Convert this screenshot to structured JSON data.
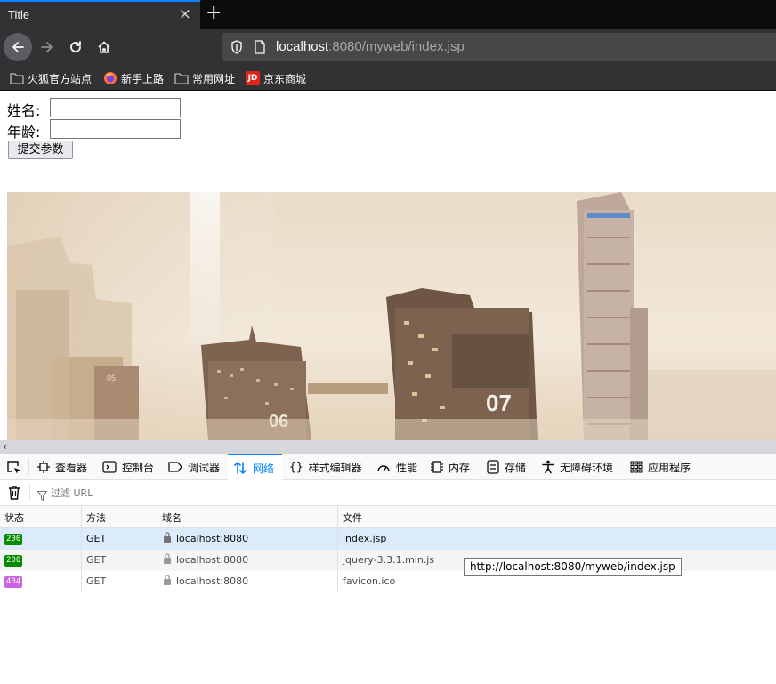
{
  "browser": {
    "tab_title": "Title",
    "tab_close": "×",
    "new_tab": "+",
    "url_host": "localhost",
    "url_rest": ":8080/myweb/index.jsp"
  },
  "bookmarks": [
    {
      "label": "火狐官方站点",
      "icon": "folder-icon"
    },
    {
      "label": "新手上路",
      "icon": "firefox-icon"
    },
    {
      "label": "常用网址",
      "icon": "folder-icon"
    },
    {
      "label": "京东商城",
      "icon": "jd-icon",
      "badge": "JD"
    }
  ],
  "form": {
    "name_label": "姓名:",
    "name_value": "",
    "age_label": "年龄:",
    "age_value": "",
    "submit_label": "提交参数"
  },
  "banner": {
    "building_1_number": "06",
    "building_2_number": "07",
    "building_3_number": "05"
  },
  "devtools": {
    "tabs": [
      {
        "label": "查看器",
        "icon": "inspector-icon"
      },
      {
        "label": "控制台",
        "icon": "console-icon"
      },
      {
        "label": "调试器",
        "icon": "debugger-icon"
      },
      {
        "label": "网络",
        "icon": "network-icon",
        "active": true
      },
      {
        "label": "样式编辑器",
        "icon": "style-editor-icon"
      },
      {
        "label": "性能",
        "icon": "performance-icon"
      },
      {
        "label": "内存",
        "icon": "memory-icon"
      },
      {
        "label": "存储",
        "icon": "storage-icon"
      },
      {
        "label": "无障碍环境",
        "icon": "accessibility-icon"
      },
      {
        "label": "应用程序",
        "icon": "application-icon"
      }
    ],
    "filter_placeholder": "过滤 URL",
    "columns": {
      "status": "状态",
      "method": "方法",
      "domain": "域名",
      "file": "文件"
    },
    "requests": [
      {
        "status": "200",
        "status_color": "#058b00",
        "method": "GET",
        "domain": "localhost:8080",
        "file": "index.jsp"
      },
      {
        "status": "200",
        "status_color": "#058b00",
        "method": "GET",
        "domain": "localhost:8080",
        "file": "jquery-3.3.1.min.js"
      },
      {
        "status": "404",
        "status_color": "#c965e0",
        "method": "GET",
        "domain": "localhost:8080",
        "file": "favicon.ico"
      }
    ],
    "tooltip": "http://localhost:8080/myweb/index.jsp"
  },
  "colors": {
    "accent": "#0a84ff",
    "chrome_dark": "#323234",
    "selected_row": "#dcebfb"
  }
}
